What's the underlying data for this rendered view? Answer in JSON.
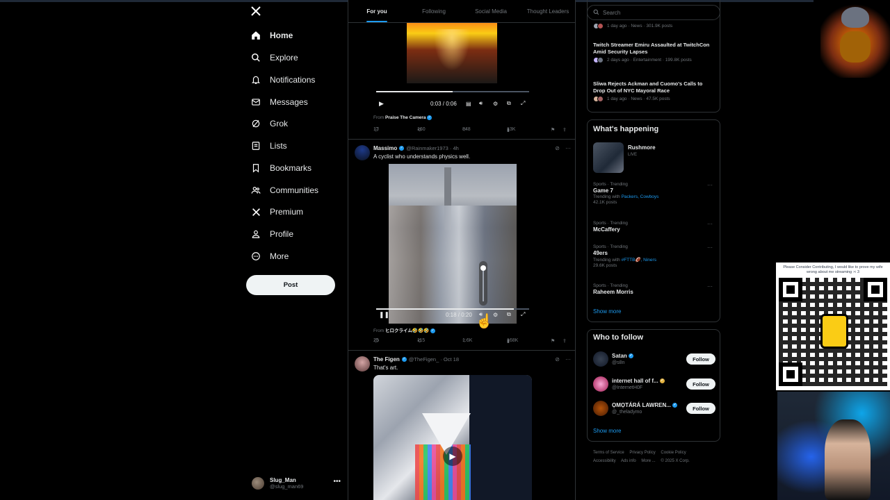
{
  "nav": {
    "items": [
      {
        "label": "Home",
        "icon": "home-icon"
      },
      {
        "label": "Explore",
        "icon": "search-icon"
      },
      {
        "label": "Notifications",
        "icon": "bell-icon"
      },
      {
        "label": "Messages",
        "icon": "mail-icon"
      },
      {
        "label": "Grok",
        "icon": "grok-icon"
      },
      {
        "label": "Lists",
        "icon": "list-icon"
      },
      {
        "label": "Bookmarks",
        "icon": "bookmark-icon"
      },
      {
        "label": "Communities",
        "icon": "people-icon"
      },
      {
        "label": "Premium",
        "icon": "x-logo-icon"
      },
      {
        "label": "Profile",
        "icon": "person-icon"
      },
      {
        "label": "More",
        "icon": "more-circle-icon"
      }
    ],
    "post_label": "Post",
    "account": {
      "name": "Slug_Man",
      "handle": "@slug_man69"
    }
  },
  "tabs": [
    "For you",
    "Following",
    "Social Media",
    "Thought Leaders"
  ],
  "feed": {
    "video1": {
      "time": "0:03 / 0:06",
      "progress": 0.5,
      "from_prefix": "From",
      "from_name": "Praise The Camera",
      "replies": "17",
      "reposts": "160",
      "likes": "848",
      "views": "13K"
    },
    "tweet2": {
      "name": "Massimo",
      "handle": "@Rainmaker1973 · 4h",
      "text": "A cyclist who understands physics well.",
      "time": "0:18 / 0:20",
      "progress": 0.9,
      "volume": 1.0,
      "from_prefix": "From",
      "from_name": "ヒロクライム🤣🤣🤣",
      "replies": "25",
      "reposts": "115",
      "likes": "1.6K",
      "views": "168K"
    },
    "tweet3": {
      "name": "The Figen",
      "handle": "@TheFigen_ · Oct 18",
      "text": "That's art."
    }
  },
  "right": {
    "search_placeholder": "Search",
    "news": [
      {
        "title": "",
        "meta": "1 day ago · News · 301.9K posts"
      },
      {
        "title": "Twitch Streamer Emiru Assaulted at TwitchCon Amid Security Lapses",
        "meta": "2 days ago · Entertainment · 199.8K posts"
      },
      {
        "title": "Sliwa Rejects Ackman and Cuomo's Calls to Drop Out of NYC Mayoral Race",
        "meta": "1 day ago · News · 47.5K posts"
      }
    ],
    "whats_happening_title": "What's happening",
    "live": {
      "name": "Rushmore",
      "status": "LIVE"
    },
    "trends": [
      {
        "cat": "Sports · Trending",
        "name": "Game 7",
        "sub_prefix": "Trending with",
        "sub_links": "Packers, Cowboys",
        "posts": "42.1K posts"
      },
      {
        "cat": "Sports · Trending",
        "name": "McCaffery",
        "sub_prefix": "",
        "sub_links": "",
        "posts": ""
      },
      {
        "cat": "Sports · Trending",
        "name": "49ers",
        "sub_prefix": "Trending with",
        "sub_links": "#FTTB🏈, Niners",
        "posts": "29.6K posts"
      },
      {
        "cat": "Sports · Trending",
        "name": "Raheem Morris",
        "sub_prefix": "",
        "sub_links": "",
        "posts": ""
      }
    ],
    "show_more": "Show more",
    "who_to_follow_title": "Who to follow",
    "follows": [
      {
        "name": "Satan",
        "handle": "@s8n",
        "btn": "Follow"
      },
      {
        "name": "internet hall of f...",
        "handle": "@InternetH0F",
        "btn": "Follow"
      },
      {
        "name": "ỌMỌTÁRÁ LAWREN...",
        "handle": "@_theladymo",
        "btn": "Follow"
      }
    ],
    "show_more_2": "Show more",
    "footer": [
      "Terms of Service",
      "Privacy Policy",
      "Cookie Policy",
      "Accessibility",
      "Ads info",
      "More ...",
      "© 2025 X Corp."
    ]
  },
  "overlay": {
    "qr_text": "Please Consider Contributing, I would like to prove my wife wrong about me streaming :< 3"
  },
  "colors": {
    "accent": "#1d9bf0",
    "background": "#000000",
    "border": "#2f3336",
    "muted": "#71767b"
  }
}
